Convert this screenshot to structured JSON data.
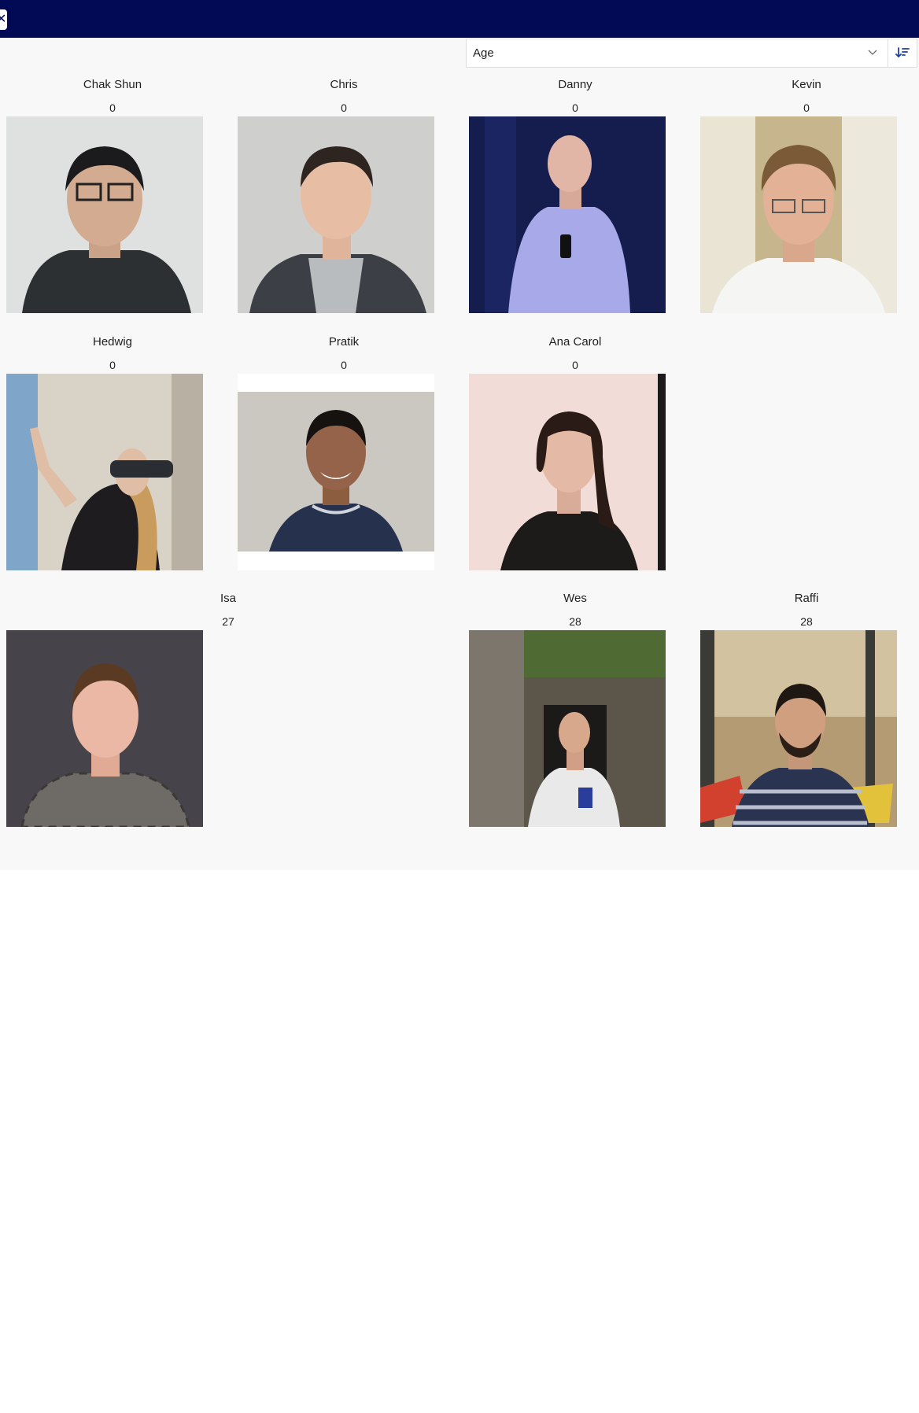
{
  "topbar": {
    "close_glyph": "✕",
    "background": "#030a55"
  },
  "sort": {
    "selected": "Age",
    "chevron_icon": "chevron-down-icon",
    "direction_icon": "sort-ascending-icon",
    "accent": "#1b3fae"
  },
  "people": [
    {
      "name": "Chak Shun",
      "age": "0"
    },
    {
      "name": "Chris",
      "age": "0"
    },
    {
      "name": "Danny",
      "age": "0"
    },
    {
      "name": "Kevin",
      "age": "0"
    },
    {
      "name": "Hedwig",
      "age": "0"
    },
    {
      "name": "Pratik",
      "age": "0"
    },
    {
      "name": "Ana Carol",
      "age": "0"
    },
    {
      "name": "Isa",
      "age": "27"
    },
    {
      "name": "Wes",
      "age": "28"
    },
    {
      "name": "Raffi",
      "age": "28"
    }
  ]
}
